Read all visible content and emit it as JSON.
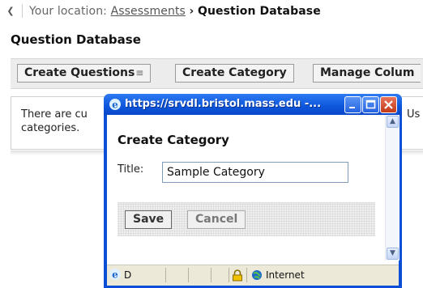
{
  "breadcrumb": {
    "prefix": "Your location:",
    "link": "Assessments",
    "arrow": "›",
    "current": "Question Database"
  },
  "page_title": "Question Database",
  "toolbar": {
    "create_questions": "Create Questions",
    "create_category": "Create Category",
    "manage_columns": "Manage Colum"
  },
  "message": {
    "line1_left": "There are cu",
    "line1_right": "Us",
    "line2": "categories."
  },
  "popup": {
    "title": "https://srvdl.bristol.mass.edu -...",
    "heading": "Create Category",
    "title_label": "Title:",
    "title_value": "Sample Category",
    "save": "Save",
    "cancel": "Cancel",
    "status_text": "D",
    "zone": "Internet"
  },
  "colors": {
    "titlebar": "#0a4fd6",
    "toolbar_bg": "#ececec",
    "close_button": "#c13a18"
  }
}
